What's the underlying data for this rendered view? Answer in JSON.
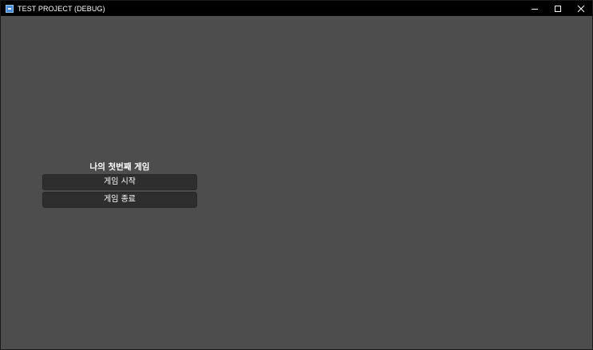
{
  "window": {
    "title": "TEST PROJECT (DEBUG)",
    "icon": "app-icon",
    "controls": [
      "minimize-icon",
      "maximize-icon",
      "close-icon"
    ]
  },
  "menu": {
    "title": "나의 첫번째 게임",
    "start_label": "게임 시작",
    "quit_label": "게임 종료"
  },
  "colors": {
    "background": "#4d4d4d",
    "titlebar": "#000000",
    "button": "#2e2e2e",
    "text": "#ffffff"
  }
}
